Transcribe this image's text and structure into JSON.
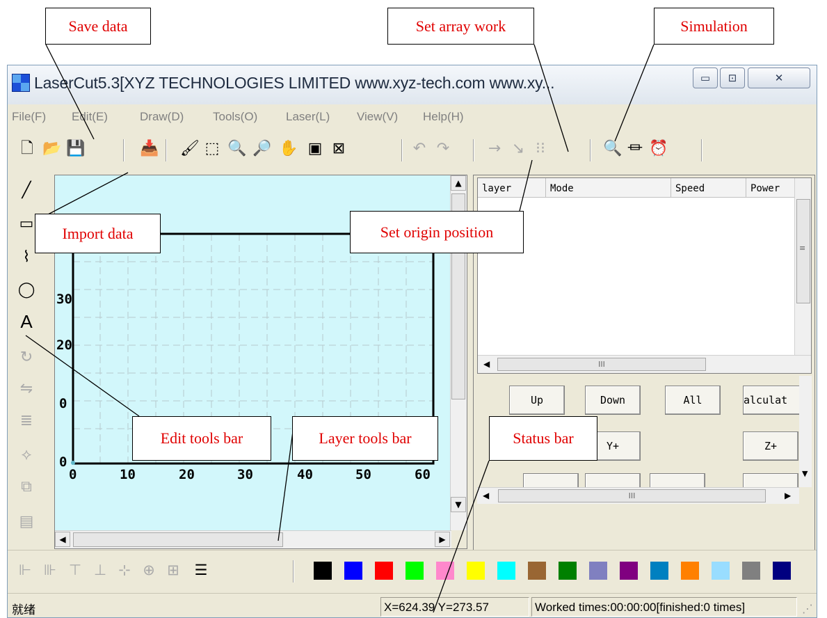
{
  "window": {
    "title": "LaserCut5.3[XYZ TECHNOLOGIES LIMITED www.xyz-tech.com www.xy...",
    "controls": {
      "minimize": "▭",
      "maximize": "⊡",
      "close": "✕"
    }
  },
  "menu": [
    "File(F)",
    "Edit(E)",
    "Draw(D)",
    "Tools(O)",
    "Laser(L)",
    "View(V)",
    "Help(H)"
  ],
  "toolbar": [
    {
      "icon": "new-file-icon",
      "glyph": "🗋",
      "enabled": true
    },
    {
      "icon": "open-folder-icon",
      "glyph": "📂",
      "enabled": true
    },
    {
      "icon": "save-icon",
      "glyph": "💾",
      "enabled": true
    },
    {
      "icon": "import-icon",
      "glyph": "📥",
      "enabled": true
    },
    {
      "icon": "brush-icon",
      "glyph": "🖌",
      "enabled": true
    },
    {
      "icon": "select-icon",
      "glyph": "⬚",
      "enabled": true
    },
    {
      "icon": "zoom-in-icon",
      "glyph": "🔍",
      "enabled": true
    },
    {
      "icon": "zoom-out-icon",
      "glyph": "🔎",
      "enabled": true
    },
    {
      "icon": "pan-hand-icon",
      "glyph": "✋",
      "enabled": true
    },
    {
      "icon": "page-view-icon",
      "glyph": "▣",
      "enabled": true
    },
    {
      "icon": "fit-view-icon",
      "glyph": "⊠",
      "enabled": true
    },
    {
      "icon": "undo-icon",
      "glyph": "↶",
      "enabled": false
    },
    {
      "icon": "redo-icon",
      "glyph": "↷",
      "enabled": false
    },
    {
      "icon": "arrow-icon",
      "glyph": "→",
      "enabled": false
    },
    {
      "icon": "set-origin-icon",
      "glyph": "↘",
      "enabled": false
    },
    {
      "icon": "array-icon",
      "glyph": "⁝⁝",
      "enabled": false
    },
    {
      "icon": "simulation-icon",
      "glyph": "🔍",
      "enabled": true
    },
    {
      "icon": "measure-icon",
      "glyph": "⏛",
      "enabled": true
    },
    {
      "icon": "alarm-clock-icon",
      "glyph": "⏰",
      "enabled": true
    }
  ],
  "left_tools": [
    {
      "icon": "line-icon",
      "glyph": "╱",
      "enabled": true
    },
    {
      "icon": "rectangle-icon",
      "glyph": "▭",
      "enabled": true
    },
    {
      "icon": "polyline-icon",
      "glyph": "⌇",
      "enabled": true
    },
    {
      "icon": "ellipse-icon",
      "glyph": "◯",
      "enabled": true
    },
    {
      "icon": "text-icon",
      "glyph": "A",
      "enabled": true
    },
    {
      "icon": "rotate-icon",
      "glyph": "↻",
      "enabled": false
    },
    {
      "icon": "mirror-icon",
      "glyph": "⇋",
      "enabled": false
    },
    {
      "icon": "align-icon",
      "glyph": "≣",
      "enabled": false
    },
    {
      "icon": "node-edit-icon",
      "glyph": "⟡",
      "enabled": false
    },
    {
      "icon": "crop-icon",
      "glyph": "⧉",
      "enabled": false
    },
    {
      "icon": "grid-toggle-icon",
      "glyph": "▤",
      "enabled": false
    }
  ],
  "canvas": {
    "background": "#d2f7fb",
    "x_ticks": [
      "0",
      "10",
      "20",
      "30",
      "40",
      "50",
      "60"
    ],
    "y_ticks": [
      "0",
      "0",
      "20",
      "30"
    ]
  },
  "layer_table": {
    "columns": [
      "layer",
      "Mode",
      "Speed",
      "Power"
    ],
    "scrollbar_glyph": "III"
  },
  "buttons": {
    "up": "Up",
    "down": "Down",
    "all": "All",
    "calculate": "alculat",
    "y_plus": "Y+",
    "z_plus": "Z+",
    "scrollbar_glyph": "III"
  },
  "layer_tools": [
    {
      "icon": "align-left-icon",
      "glyph": "⊩"
    },
    {
      "icon": "align-right-icon",
      "glyph": "⊪"
    },
    {
      "icon": "align-top-icon",
      "glyph": "⊤"
    },
    {
      "icon": "align-bottom-icon",
      "glyph": "⊥"
    },
    {
      "icon": "center-horizontal-icon",
      "glyph": "⊹"
    },
    {
      "icon": "center-vertical-icon",
      "glyph": "⊕"
    },
    {
      "icon": "center-both-icon",
      "glyph": "⊞"
    },
    {
      "icon": "layers-icon",
      "glyph": "☰"
    }
  ],
  "palette": [
    "#000000",
    "#0000ff",
    "#ff0000",
    "#00ff00",
    "#ff88cc",
    "#ffff00",
    "#00ffff",
    "#996633",
    "#008000",
    "#8080c0",
    "#800080",
    "#0080c0",
    "#ff8000",
    "#99ddff",
    "#808080",
    "#000080"
  ],
  "status": {
    "ready": "就绪",
    "coords": "X=624.39 Y=273.57",
    "worked": "Worked times:00:00:00[finished:0 times]"
  },
  "callouts": {
    "save_data": "Save data",
    "set_array_work": "Set array work",
    "simulation": "Simulation",
    "import_data": "Import data",
    "set_origin_position": "Set origin position",
    "edit_tools_bar": "Edit tools bar",
    "layer_tools_bar": "Layer tools bar",
    "status_bar": "Status bar"
  }
}
